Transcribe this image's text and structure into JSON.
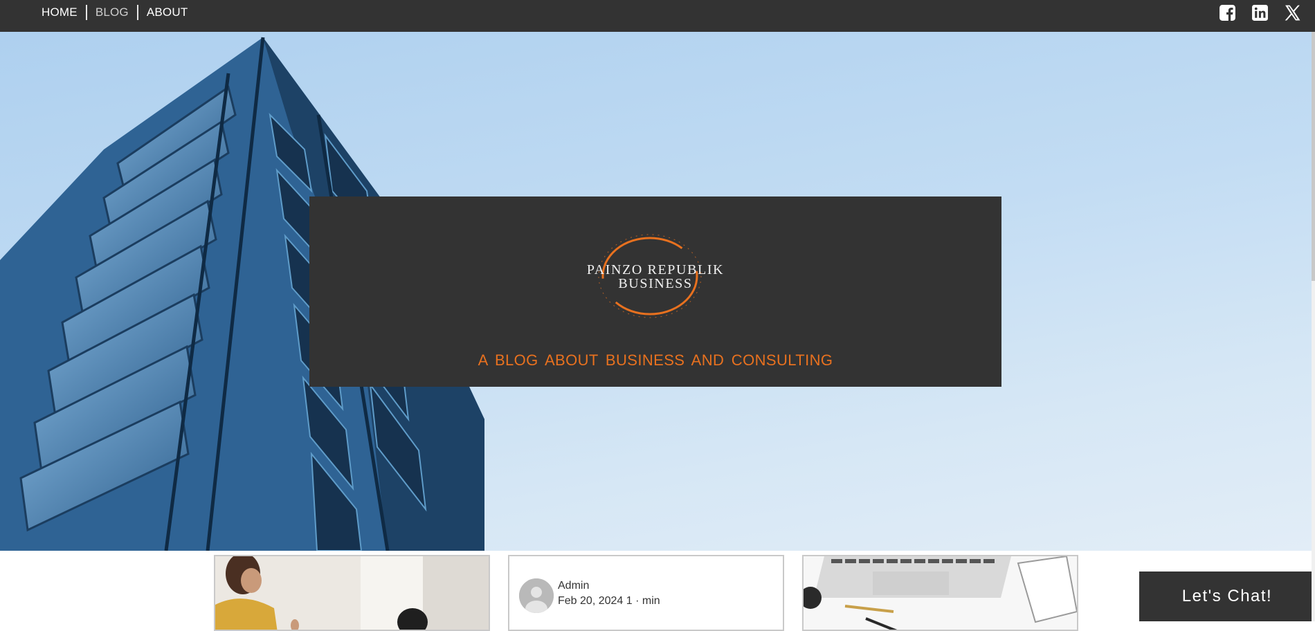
{
  "nav": {
    "items": [
      {
        "label": "HOME"
      },
      {
        "label": "BLOG"
      },
      {
        "label": "ABOUT"
      }
    ]
  },
  "social": {
    "icons": [
      "facebook-icon",
      "linkedin-icon",
      "x-icon"
    ]
  },
  "banner": {
    "logo_line1": "PAINZO REPUBLIK",
    "logo_line2": "BUSINESS",
    "tagline": "A BLOG ABOUT BUSINESS AND CONSULTING"
  },
  "posts": [
    {
      "image": "people-meeting-photo"
    },
    {
      "author": "Admin",
      "meta": "Feb 20, 2024 1 · min"
    },
    {
      "image": "laptop-desk-photo"
    }
  ],
  "chat": {
    "label": "Let's Chat!"
  },
  "colors": {
    "dark": "#333333",
    "accent": "#e8711f",
    "sky": "#c2dcf3"
  }
}
